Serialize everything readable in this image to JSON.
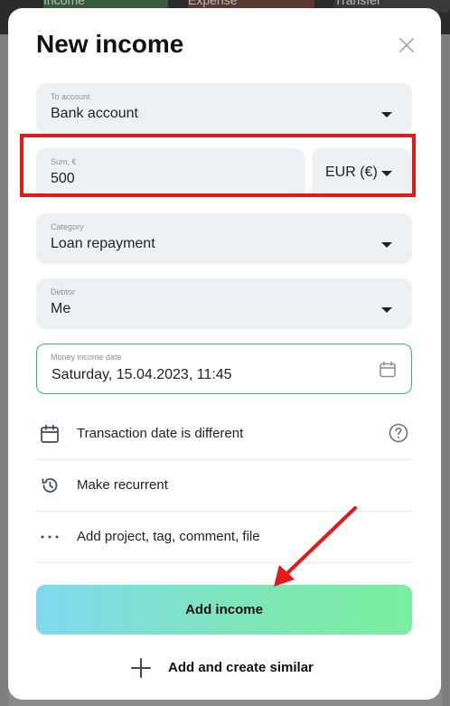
{
  "background": {
    "tabs": {
      "income": "Income",
      "expense": "Expense",
      "transfer": "Transfer"
    }
  },
  "modal": {
    "title": "New income",
    "close_icon": "close-icon",
    "account": {
      "label": "To account",
      "value": "Bank account"
    },
    "sum": {
      "label": "Sum, €",
      "value": "500"
    },
    "currency": {
      "value": "EUR (€)"
    },
    "category": {
      "label": "Category",
      "value": "Loan repayment"
    },
    "debtor": {
      "label": "Debtor",
      "value": "Me"
    },
    "date": {
      "label": "Money income date",
      "value": "Saturday, 15.04.2023, 11:45"
    },
    "options": [
      {
        "label": "Transaction date is different",
        "icon": "calendar-icon",
        "help_icon": "help-icon"
      },
      {
        "label": "Make recurrent",
        "icon": "history-icon"
      },
      {
        "label": "Add project, tag, comment, file",
        "icon": "more-dots-icon"
      }
    ],
    "primary_button": "Add income",
    "secondary_button": "Add and create similar"
  },
  "colors": {
    "highlight": "#e21a1a",
    "accent_green": "#3cb96a",
    "button_gradient_start": "#7fd9ee",
    "button_gradient_end": "#79ee9f"
  }
}
